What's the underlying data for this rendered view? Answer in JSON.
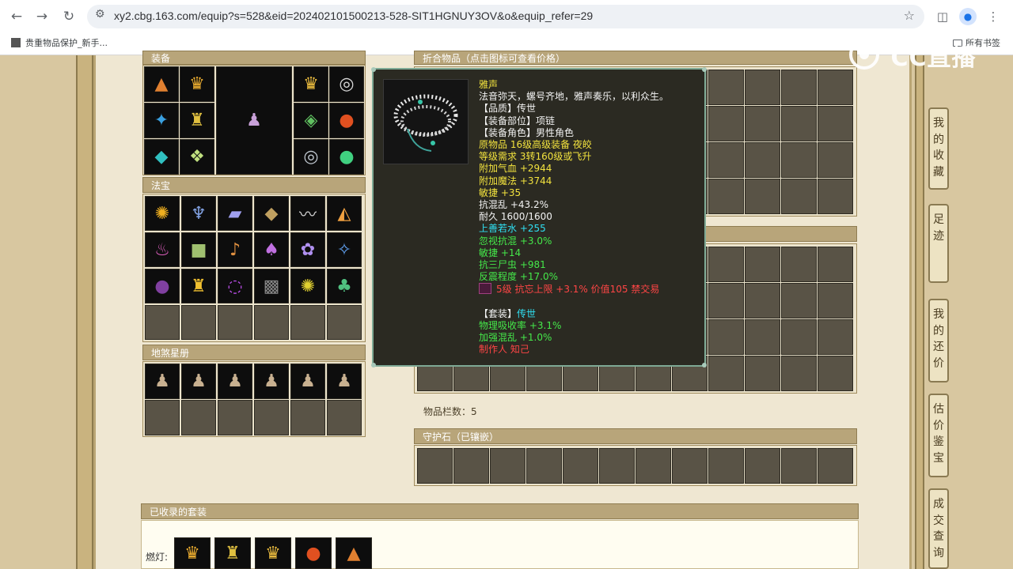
{
  "browser": {
    "url": "xy2.cbg.163.com/equip?s=528&eid=202402101500213-528-SIT1HGNUY3OV&o&equip_refer=29",
    "bookmark": "贵重物品保护_新手...",
    "all_bookmarks": "所有书签",
    "back_icon": "arrow-left-icon",
    "forward_icon": "arrow-right-icon",
    "reload_icon": "reload-icon"
  },
  "panels": {
    "equipment": "装备",
    "fabao": "法宝",
    "disha": "地煞星册",
    "items_header": "折合物品（点击图标可查看价格）",
    "item_count": "物品栏数：5",
    "guard_stone": "守护石（已镶嵌）",
    "collected_sets": "已收录的套装",
    "set_label": "燃灯:"
  },
  "tooltip": {
    "name": "雅声",
    "lines": [
      {
        "text": "法音弥天，螺号齐地，雅声奏乐，以利众生。",
        "color": "white"
      },
      {
        "text": "【品质】传世",
        "color": "white"
      },
      {
        "text": "【装备部位】项链",
        "color": "white"
      },
      {
        "text": "【装备角色】男性角色",
        "color": "white"
      },
      {
        "text": "原物品 16级高级装备 夜皎",
        "color": "yellow"
      },
      {
        "text": "等级需求 3转160级或飞升",
        "color": "yellow"
      },
      {
        "text": "附加气血 +2944",
        "color": "yellow"
      },
      {
        "text": "附加魔法 +3744",
        "color": "yellow"
      },
      {
        "text": "敏捷 +35",
        "color": "yellow"
      },
      {
        "text": "抗混乱 +43.2%",
        "color": "white"
      },
      {
        "text": "耐久 1600/1600",
        "color": "white"
      },
      {
        "text": "上善若水 +255",
        "color": "cyan"
      },
      {
        "text": "忽视抗混 +3.0%",
        "color": "green"
      },
      {
        "text": "敏捷 +14",
        "color": "green"
      },
      {
        "text": "抗三尸虫 +981",
        "color": "green"
      },
      {
        "text": "反震程度 +17.0%",
        "color": "green"
      },
      {
        "text": "5级 抗忘上限 +3.1% 价值105 禁交易",
        "color": "red",
        "gem": true
      },
      {
        "text": "",
        "color": "white"
      },
      {
        "text": "【套装】传世",
        "color": "white",
        "suffix": "传世"
      },
      {
        "text": "物理吸收率 +3.1%",
        "color": "green"
      },
      {
        "text": "加强混乱 +1.0%",
        "color": "green"
      },
      {
        "text": "制作人 知己",
        "color": "red"
      }
    ]
  },
  "side_tabs": [
    "我的收藏",
    "足迹",
    "我的还价",
    "估价鉴宝",
    "成交查询"
  ],
  "watermark": "CC直播",
  "colors": {
    "white": "#f3f3f3",
    "yellow": "#f2e23e",
    "green": "#45e84a",
    "cyan": "#2fe0f3",
    "red": "#ff4545",
    "panel_header": "#b8a57a"
  }
}
